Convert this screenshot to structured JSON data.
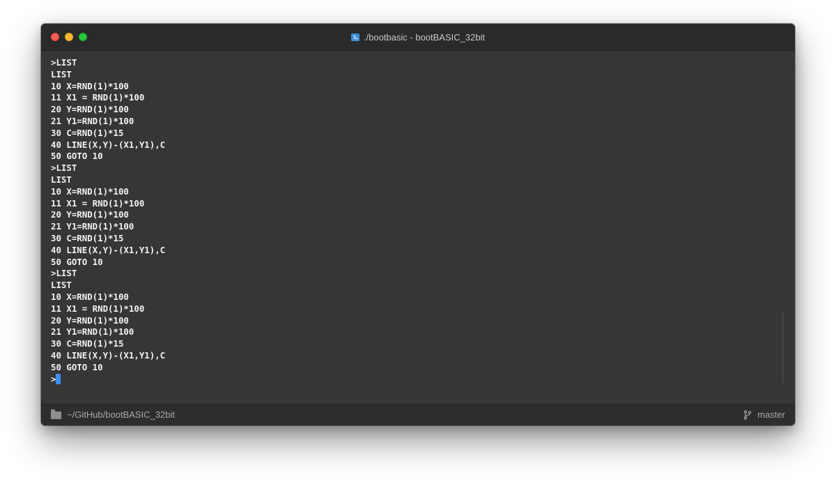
{
  "window": {
    "title": "./bootbasic - bootBASIC_32bit",
    "title_icon": "terminal-icon"
  },
  "terminal": {
    "lines": [
      ">LIST",
      "LIST",
      "10 X=RND(1)*100",
      "11 X1 = RND(1)*100",
      "20 Y=RND(1)*100",
      "21 Y1=RND(1)*100",
      "30 C=RND(1)*15",
      "40 LINE(X,Y)-(X1,Y1),C",
      "50 GOTO 10",
      ">LIST",
      "LIST",
      "10 X=RND(1)*100",
      "11 X1 = RND(1)*100",
      "20 Y=RND(1)*100",
      "21 Y1=RND(1)*100",
      "30 C=RND(1)*15",
      "40 LINE(X,Y)-(X1,Y1),C",
      "50 GOTO 10",
      ">LIST",
      "LIST",
      "10 X=RND(1)*100",
      "11 X1 = RND(1)*100",
      "20 Y=RND(1)*100",
      "21 Y1=RND(1)*100",
      "30 C=RND(1)*15",
      "40 LINE(X,Y)-(X1,Y1),C",
      "50 GOTO 10"
    ],
    "prompt": ">",
    "cursor_color": "#3e8ef7"
  },
  "statusbar": {
    "path": "~/GitHub/bootBASIC_32bit",
    "path_icon": "folder-icon",
    "branch": "master",
    "branch_icon": "git-branch-icon"
  },
  "colors": {
    "terminal_bg": "#363636",
    "titlebar_bg": "#2a2a2a",
    "text": "#f2f2f2",
    "close": "#fe5f57",
    "minimize": "#febc2e",
    "maximize": "#28c840"
  }
}
